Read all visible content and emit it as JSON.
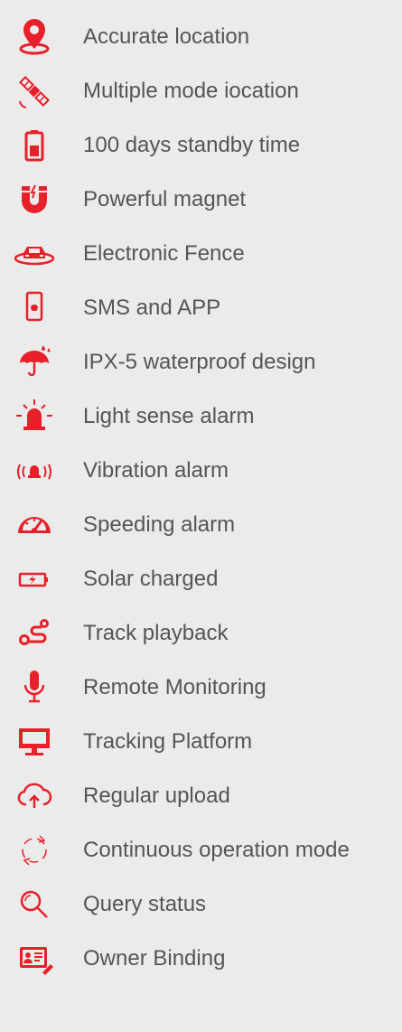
{
  "accent_color": "#e8202a",
  "text_color": "#555555",
  "background_color": "#ebebeb",
  "features": [
    {
      "label": "Accurate location",
      "icon": "location-pin-icon"
    },
    {
      "label": "Multiple mode iocation",
      "icon": "satellite-icon"
    },
    {
      "label": "100 days standby time",
      "icon": "battery-icon"
    },
    {
      "label": "Powerful magnet",
      "icon": "magnet-icon"
    },
    {
      "label": "Electronic Fence",
      "icon": "car-icon"
    },
    {
      "label": "SMS and APP",
      "icon": "smartphone-icon"
    },
    {
      "label": "IPX-5 waterproof design",
      "icon": "umbrella-icon"
    },
    {
      "label": "Light sense alarm",
      "icon": "siren-icon"
    },
    {
      "label": "Vibration alarm",
      "icon": "vibration-bell-icon"
    },
    {
      "label": "Speeding alarm",
      "icon": "speedometer-icon"
    },
    {
      "label": "Solar charged",
      "icon": "charging-battery-icon"
    },
    {
      "label": "Track playback",
      "icon": "route-icon"
    },
    {
      "label": "Remote Monitoring",
      "icon": "microphone-icon"
    },
    {
      "label": "Tracking Platform",
      "icon": "monitor-icon"
    },
    {
      "label": "Regular upload",
      "icon": "cloud-upload-icon"
    },
    {
      "label": "Continuous operation mode",
      "icon": "cycle-arrows-icon"
    },
    {
      "label": "Query status",
      "icon": "search-icon"
    },
    {
      "label": "Owner Binding",
      "icon": "id-card-icon"
    }
  ]
}
